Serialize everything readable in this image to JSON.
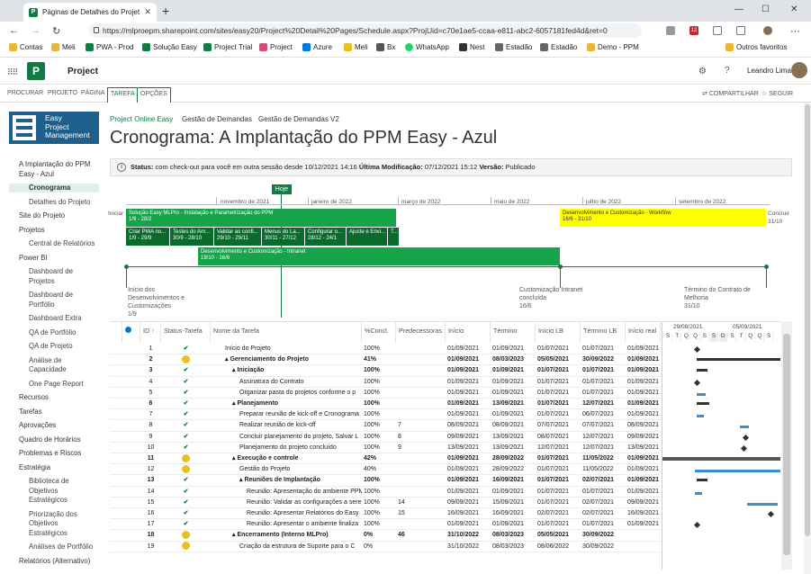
{
  "browser": {
    "tab_title": "Páginas de Detalhes do Projeto",
    "url": "https://mlproepm.sharepoint.com/sites/easy20/Project%20Detail%20Pages/Schedule.aspx?ProjUid=c70e1ae5-ccaa-e811-abc2-6057181fed4d&ret=0",
    "ext_badge": "12",
    "bookmarks": [
      "Contas",
      "Meli",
      "PWA - Prod",
      "Solução Easy",
      "Project Trial",
      "Project",
      "Azure",
      "Meli",
      "Bx",
      "WhatsApp",
      "Nest",
      "Estadão",
      "Estadão",
      "Demo - PPM"
    ],
    "other_bookmarks": "Outros favoritos"
  },
  "suite": {
    "app": "Project",
    "user": "Leandro Lima"
  },
  "ribbon": {
    "tabs": [
      "PROCURAR",
      "PROJETO",
      "PÁGINA",
      "TAREFA",
      "OPÇÕES"
    ],
    "share": "COMPARTILHAR",
    "follow": "SEGUIR"
  },
  "logo": {
    "line1": "Easy",
    "line2": "Project",
    "line3": "Management"
  },
  "leftnav": [
    {
      "label": "A Implantação do PPM",
      "type": "top"
    },
    {
      "label": "Easy - Azul",
      "type": "top"
    },
    {
      "label": "Cronograma",
      "type": "sel"
    },
    {
      "label": "Detalhes do Projeto",
      "type": "sub"
    },
    {
      "label": "Site do Projeto",
      "type": "top"
    },
    {
      "label": "Projetos",
      "type": "top"
    },
    {
      "label": "Central de Relatórios",
      "type": "sub"
    },
    {
      "label": "Power BI",
      "type": "top"
    },
    {
      "label": "Dashboard de",
      "type": "sub"
    },
    {
      "label": "Projetos",
      "type": "sub"
    },
    {
      "label": "Dashboard de",
      "type": "sub"
    },
    {
      "label": "Portfólio",
      "type": "sub"
    },
    {
      "label": "Dashboard Extra",
      "type": "sub"
    },
    {
      "label": "QA de Portfólio",
      "type": "sub"
    },
    {
      "label": "QA de Projeto",
      "type": "sub"
    },
    {
      "label": "Análise de",
      "type": "sub"
    },
    {
      "label": "Capacidade",
      "type": "sub"
    },
    {
      "label": "One Page Report",
      "type": "sub"
    },
    {
      "label": "Recursos",
      "type": "top"
    },
    {
      "label": "Tarefas",
      "type": "top"
    },
    {
      "label": "Aprovações",
      "type": "top"
    },
    {
      "label": "Quadro de Horários",
      "type": "top"
    },
    {
      "label": "Problemas e Riscos",
      "type": "top"
    },
    {
      "label": "Estratégia",
      "type": "top"
    },
    {
      "label": "Biblioteca de",
      "type": "sub"
    },
    {
      "label": "Objetivos",
      "type": "sub"
    },
    {
      "label": "Estratégicos",
      "type": "sub"
    },
    {
      "label": "Priorização dos",
      "type": "sub"
    },
    {
      "label": "Objetivos",
      "type": "sub"
    },
    {
      "label": "Estratégicos",
      "type": "sub"
    },
    {
      "label": "Análises de Portfólio",
      "type": "sub"
    },
    {
      "label": "Relatórios (Alternativo)",
      "type": "top"
    }
  ],
  "breadcrumbs": [
    "Project Online Easy",
    "Gestão de Demandas",
    "Gestão de Demandas V2"
  ],
  "page_title": "Cronograma: A Implantação do PPM Easy - Azul",
  "status": {
    "label": "Status:",
    "text": "com check-out para você em outra sessão desde 10/12/2021 14:16",
    "mod_label": "Última Modificação:",
    "mod_value": "07/12/2021 15:12",
    "ver_label": "Versão:",
    "ver_value": "Publicado"
  },
  "timeline": {
    "today": "Hoje",
    "start": "Iniciar",
    "end": "Concluir",
    "end_date": "31/10",
    "months": [
      "novembro de 2021",
      "janeiro de 2022",
      "março de 2022",
      "maio de 2022",
      "julho de 2022",
      "setembro de 2022"
    ],
    "bars": [
      {
        "name": "Solução Easy MLPro - Instalação e Parametrização do PPM",
        "dates": "1/9 - 28/2"
      },
      {
        "name": "Desenvolvimento e Customização - Workflow",
        "dates": "16/6 - 31/10"
      },
      {
        "name": "Criar PWA no...",
        "dates": "1/9 - 29/9"
      },
      {
        "name": "Testes do Am...",
        "dates": "30/9 - 28/10"
      },
      {
        "name": "Validar as confi...",
        "dates": "29/10 - 29/11"
      },
      {
        "name": "Menus do La...",
        "dates": "30/11 - 27/12"
      },
      {
        "name": "Configurar o...",
        "dates": "28/12 - 24/1"
      },
      {
        "name": "Ajuste e Envi...",
        "dates": ""
      },
      {
        "name": "T...",
        "dates": ""
      },
      {
        "name": "Desenvolvimento e Customização - Intranet",
        "dates": "19/10 - 16/6"
      }
    ],
    "milestones": [
      {
        "label": "Início dos Desenvolvimentos e Customizações",
        "date": "1/9"
      },
      {
        "label": "Customização Intranet concluída",
        "date": "16/6"
      },
      {
        "label": "Término do Contrato de Melhoria",
        "date": "31/10"
      }
    ]
  },
  "grid": {
    "columns": [
      "ID ↑",
      "Status-Tarefa",
      "Nome da Tarefa",
      "%Concl.",
      "Predecessoras",
      "Início",
      "Término",
      "Início LB",
      "Término LB",
      "Início real"
    ],
    "rows": [
      {
        "id": "1",
        "st": "check",
        "name": "Início do Projeto",
        "lvl": 0,
        "pct": "100%",
        "pred": "",
        "ini": "01/09/2021",
        "ter": "01/09/2021",
        "ilb": "01/07/2021",
        "tlb": "01/07/2021",
        "ir": "01/09/2021",
        "b": false
      },
      {
        "id": "2",
        "st": "smile",
        "name": "Gerenciamento do Projeto",
        "lvl": 0,
        "sum": true,
        "pct": "41%",
        "pred": "",
        "ini": "01/09/2021",
        "ter": "08/03/2023",
        "ilb": "05/05/2021",
        "tlb": "30/09/2022",
        "ir": "01/09/2021",
        "b": true
      },
      {
        "id": "3",
        "st": "check",
        "name": "Iniciação",
        "lvl": 1,
        "sum": true,
        "pct": "100%",
        "pred": "",
        "ini": "01/09/2021",
        "ter": "01/09/2021",
        "ilb": "01/07/2021",
        "tlb": "01/07/2021",
        "ir": "01/09/2021",
        "b": true
      },
      {
        "id": "4",
        "st": "check",
        "name": "Assinatura do Contrato",
        "lvl": 2,
        "pct": "100%",
        "pred": "",
        "ini": "01/09/2021",
        "ter": "01/09/2021",
        "ilb": "01/07/2021",
        "tlb": "01/07/2021",
        "ir": "01/09/2021",
        "b": false
      },
      {
        "id": "5",
        "st": "check",
        "name": "Organizar pasta do projetos conforme o p",
        "lvl": 2,
        "pct": "100%",
        "pred": "",
        "ini": "01/09/2021",
        "ter": "01/09/2021",
        "ilb": "01/07/2021",
        "tlb": "01/07/2021",
        "ir": "01/09/2021",
        "b": false
      },
      {
        "id": "6",
        "st": "check",
        "name": "Planejamento",
        "lvl": 1,
        "sum": true,
        "pct": "100%",
        "pred": "",
        "ini": "01/09/2021",
        "ter": "13/09/2021",
        "ilb": "01/07/2021",
        "tlb": "12/07/2021",
        "ir": "01/09/2021",
        "b": true
      },
      {
        "id": "7",
        "st": "check",
        "name": "Preparar reunião de kick-off e Cronograma",
        "lvl": 2,
        "pct": "100%",
        "pred": "",
        "ini": "01/09/2021",
        "ter": "01/09/2021",
        "ilb": "01/07/2021",
        "tlb": "06/07/2021",
        "ir": "01/09/2021",
        "b": false
      },
      {
        "id": "8",
        "st": "check",
        "name": "Realizar reunião de kick-off",
        "lvl": 2,
        "pct": "100%",
        "pred": "7",
        "ini": "08/09/2021",
        "ter": "08/09/2021",
        "ilb": "07/07/2021",
        "tlb": "07/07/2021",
        "ir": "08/09/2021",
        "b": false
      },
      {
        "id": "9",
        "st": "check",
        "name": "Concluir planejamento do projeto, Salvar L",
        "lvl": 2,
        "pct": "100%",
        "pred": "8",
        "ini": "09/09/2021",
        "ter": "13/09/2021",
        "ilb": "08/07/2021",
        "tlb": "12/07/2021",
        "ir": "09/09/2021",
        "b": false
      },
      {
        "id": "10",
        "st": "check",
        "name": "Planejamento do projeto concluído",
        "lvl": 2,
        "pct": "100%",
        "pred": "9",
        "ini": "13/09/2021",
        "ter": "13/09/2021",
        "ilb": "12/07/2021",
        "tlb": "12/07/2021",
        "ir": "13/09/2021",
        "b": false
      },
      {
        "id": "11",
        "st": "smile",
        "name": "Execução e controle",
        "lvl": 1,
        "sum": true,
        "pct": "42%",
        "pred": "",
        "ini": "01/09/2021",
        "ter": "28/09/2022",
        "ilb": "01/07/2021",
        "tlb": "11/05/2022",
        "ir": "01/09/2021",
        "b": true
      },
      {
        "id": "12",
        "st": "smile",
        "name": "Gestão do Projeto",
        "lvl": 2,
        "pct": "40%",
        "pred": "",
        "ini": "01/09/2021",
        "ter": "28/09/2022",
        "ilb": "01/07/2021",
        "tlb": "11/05/2022",
        "ir": "01/09/2021",
        "b": false
      },
      {
        "id": "13",
        "st": "check",
        "name": "Reuniões de Implantação",
        "lvl": 2,
        "sum": true,
        "pct": "100%",
        "pred": "",
        "ini": "01/09/2021",
        "ter": "16/09/2021",
        "ilb": "01/07/2021",
        "tlb": "02/07/2021",
        "ir": "01/09/2021",
        "b": true
      },
      {
        "id": "14",
        "st": "check",
        "name": "Reunião: Apresentação do ambiente PPM",
        "lvl": 3,
        "pct": "100%",
        "pred": "",
        "ini": "01/09/2021",
        "ter": "01/09/2021",
        "ilb": "01/07/2021",
        "tlb": "01/07/2021",
        "ir": "01/09/2021",
        "b": false
      },
      {
        "id": "15",
        "st": "check",
        "name": "Reunião: Validar as configurações a sere",
        "lvl": 3,
        "pct": "100%",
        "pred": "14",
        "ini": "09/09/2021",
        "ter": "15/09/2021",
        "ilb": "01/07/2021",
        "tlb": "02/07/2021",
        "ir": "09/09/2021",
        "b": false
      },
      {
        "id": "16",
        "st": "check",
        "name": "Reunião: Apresentar Relatórios do Easy",
        "lvl": 3,
        "pct": "100%",
        "pred": "15",
        "ini": "16/09/2021",
        "ter": "16/09/2021",
        "ilb": "02/07/2021",
        "tlb": "02/07/2021",
        "ir": "16/09/2021",
        "b": false
      },
      {
        "id": "17",
        "st": "check",
        "name": "Reunião: Apresentar o ambiente finaliza",
        "lvl": 3,
        "pct": "100%",
        "pred": "",
        "ini": "01/09/2021",
        "ter": "01/09/2021",
        "ilb": "01/07/2021",
        "tlb": "01/07/2021",
        "ir": "01/09/2021",
        "b": false
      },
      {
        "id": "18",
        "st": "smile",
        "name": "Encerramento (Interno MLPro)",
        "lvl": 1,
        "sum": true,
        "pct": "0%",
        "pred": "46",
        "ini": "31/10/2022",
        "ter": "08/03/2023",
        "ilb": "05/05/2021",
        "tlb": "30/09/2022",
        "ir": "",
        "b": true
      },
      {
        "id": "19",
        "st": "smile",
        "name": "Criação da estrutura de Suporte para o C",
        "lvl": 2,
        "pct": "0%",
        "pred": "",
        "ini": "31/10/2022",
        "ter": "08/03/2023",
        "ilb": "08/06/2022",
        "tlb": "30/09/2022",
        "ir": "",
        "b": false
      }
    ]
  },
  "gantt": {
    "weeks": [
      "29/08/2021",
      "05/09/2021"
    ],
    "days": [
      "S",
      "T",
      "Q",
      "Q",
      "S",
      "S",
      "D",
      "S",
      "T",
      "Q",
      "Q",
      "S"
    ]
  }
}
